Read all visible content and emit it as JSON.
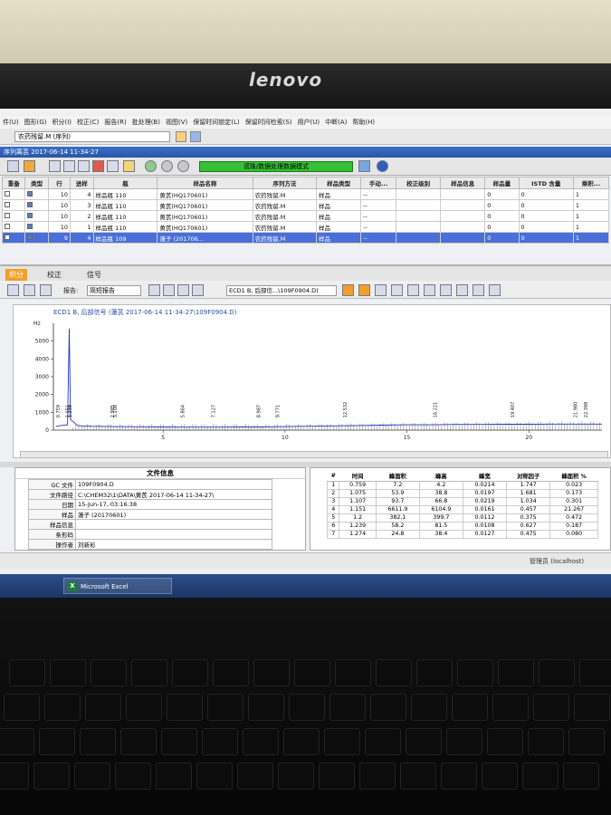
{
  "brand": "lenovo",
  "menu": [
    "件(U)",
    "图形(G)",
    "积分(I)",
    "校正(C)",
    "报告(R)",
    "批处理(B)",
    "视图(V)",
    "保留时间锁定(L)",
    "保留时间检索(S)",
    "用户(U)",
    "中断(A)",
    "帮助(H)"
  ],
  "method_box": "农药残留.M (序列)",
  "window_title": "序列离芪 2017-06-14 11-34-27",
  "status_banner": "谎珠/数据处理数据模式",
  "seq_headers": [
    "重备",
    "类型",
    "行",
    "进样",
    "瓶",
    "样品名称",
    "序列方法",
    "样品类型",
    "手动...",
    "校正级别",
    "样品信息",
    "样品量",
    "ISTD 含量",
    "乘积..."
  ],
  "seq_rows": [
    {
      "line": "10",
      "inj": "4",
      "vial": "样品瓶 110",
      "name": "黄芪(HQ170601)",
      "method": "农药残留.M",
      "type": "样品",
      "manual": "--",
      "amount": "0",
      "istd": "0",
      "mult": "1"
    },
    {
      "line": "10",
      "inj": "3",
      "vial": "样品瓶 110",
      "name": "黄芪(HQ170601)",
      "method": "农药残留.M",
      "type": "样品",
      "manual": "--",
      "amount": "0",
      "istd": "0",
      "mult": "1"
    },
    {
      "line": "10",
      "inj": "2",
      "vial": "样品瓶 110",
      "name": "黄芪(HQ170601)",
      "method": "农药残留.M",
      "type": "样品",
      "manual": "--",
      "amount": "0",
      "istd": "0",
      "mult": "1"
    },
    {
      "line": "10",
      "inj": "1",
      "vial": "样品瓶 110",
      "name": "黄芪(HQ170601)",
      "method": "农药残留.M",
      "type": "样品",
      "manual": "--",
      "amount": "0",
      "istd": "0",
      "mult": "1"
    },
    {
      "line": "9",
      "inj": "4",
      "vial": "样品瓶 109",
      "name": "蓮子 (201706...",
      "method": "农药残留.M",
      "type": "样品",
      "manual": "--",
      "amount": "0",
      "istd": "0",
      "mult": "1"
    }
  ],
  "tabs": [
    "积分",
    "校正",
    "信号"
  ],
  "report_label": "报告:",
  "report_value": "简短报告",
  "signal_value": "ECD1 B, 后部信...\\109F0904.D)",
  "chart_data": {
    "type": "line",
    "title": "ECD1 B, 后部信号 (蓮芪 2017-06-14 11-34-27\\109F0904.D)",
    "ylabel": "Hz",
    "xlabel": "",
    "ylim": [
      0,
      6000
    ],
    "yticks": [
      0,
      1000,
      2000,
      3000,
      4000,
      5000
    ],
    "xlim": [
      0.5,
      23
    ],
    "xticks": [
      5,
      10,
      15,
      20
    ],
    "x": [
      0.6,
      0.76,
      1.08,
      1.15,
      1.2,
      1.5,
      2,
      3,
      4,
      5,
      6,
      7,
      8,
      9,
      10,
      11,
      12,
      13,
      14,
      15,
      16,
      17,
      18,
      19,
      20,
      21,
      22,
      23
    ],
    "y": [
      200,
      250,
      300,
      5700,
      600,
      250,
      220,
      200,
      190,
      180,
      170,
      170,
      180,
      180,
      200,
      220,
      240,
      260,
      280,
      300,
      300,
      320,
      320,
      330,
      330,
      340,
      340,
      340
    ],
    "peak_labels": [
      "0.759",
      "1.151",
      "1.239",
      "2.985",
      "3.108",
      "5.864",
      "7.127",
      "8.987",
      "9.771",
      "12.532",
      "16.221",
      "19.407",
      "21.980",
      "22.398"
    ]
  },
  "info_title": "文件信息",
  "info_rows": [
    {
      "k": "GC 文件",
      "v": "109F0904.D"
    },
    {
      "k": "文件路径",
      "v": "C:\\CHEM32\\1\\DATA\\黄芪 2017-06-14 11-34-27\\"
    },
    {
      "k": "日期",
      "v": "15-Jun-17, 03:16:38"
    },
    {
      "k": "样品",
      "v": "蓮子 (20170601)"
    },
    {
      "k": "样品信息",
      "v": ""
    },
    {
      "k": "条形码",
      "v": ""
    },
    {
      "k": "操作者",
      "v": "刘新彩"
    }
  ],
  "peak_headers": [
    "#",
    "时间",
    "峰面积",
    "峰高",
    "峰宽",
    "对称因子",
    "峰面积 %"
  ],
  "peak_rows": [
    [
      "1",
      "0.759",
      "7.2",
      "4.2",
      "0.0214",
      "1.747",
      "0.023"
    ],
    [
      "2",
      "1.075",
      "53.9",
      "38.8",
      "0.0197",
      "1.681",
      "0.173"
    ],
    [
      "3",
      "1.107",
      "93.7",
      "66.8",
      "0.0219",
      "1.034",
      "0.301"
    ],
    [
      "4",
      "1.151",
      "6611.9",
      "6104.9",
      "0.0161",
      "0.457",
      "21.267"
    ],
    [
      "5",
      "1.2",
      "382.1",
      "399.7",
      "0.0112",
      "0.375",
      "0.472"
    ],
    [
      "6",
      "1.239",
      "58.2",
      "81.5",
      "0.0108",
      "0.627",
      "0.187"
    ],
    [
      "7",
      "1.274",
      "24.8",
      "38.4",
      "0.0127",
      "0.475",
      "0.080"
    ]
  ],
  "status_user": "管理员 (localhost)",
  "taskbar_item": "Microsoft Excel"
}
